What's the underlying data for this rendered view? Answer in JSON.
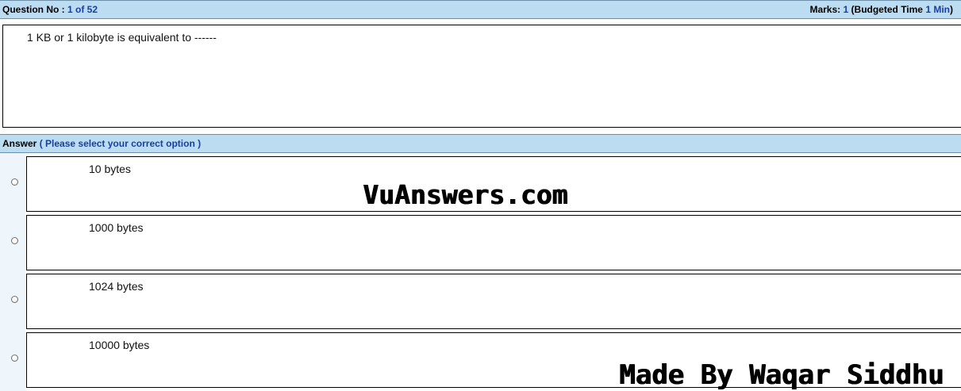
{
  "header": {
    "question_label": "Question No :",
    "question_number": "1 of 52",
    "marks_label": "Marks:",
    "marks_value": "1",
    "budget_open": "(Budgeted Time",
    "budget_value": "1 Min",
    "budget_close": ")"
  },
  "question": {
    "text": "1 KB or 1 kilobyte is equivalent to ------"
  },
  "answer_header": {
    "label": "Answer",
    "instruction": "( Please select your correct option )"
  },
  "options": [
    {
      "label": "10 bytes",
      "selected": false
    },
    {
      "label": "1000 bytes",
      "selected": false
    },
    {
      "label": "1024 bytes",
      "selected": false
    },
    {
      "label": "10000 bytes",
      "selected": false
    }
  ],
  "watermarks": {
    "site": "VuAnswers.com",
    "credit": "Made By Waqar Siddhu"
  },
  "colors": {
    "header_bar": "#bcdcf1",
    "accent_blue": "#1a3fa0"
  }
}
